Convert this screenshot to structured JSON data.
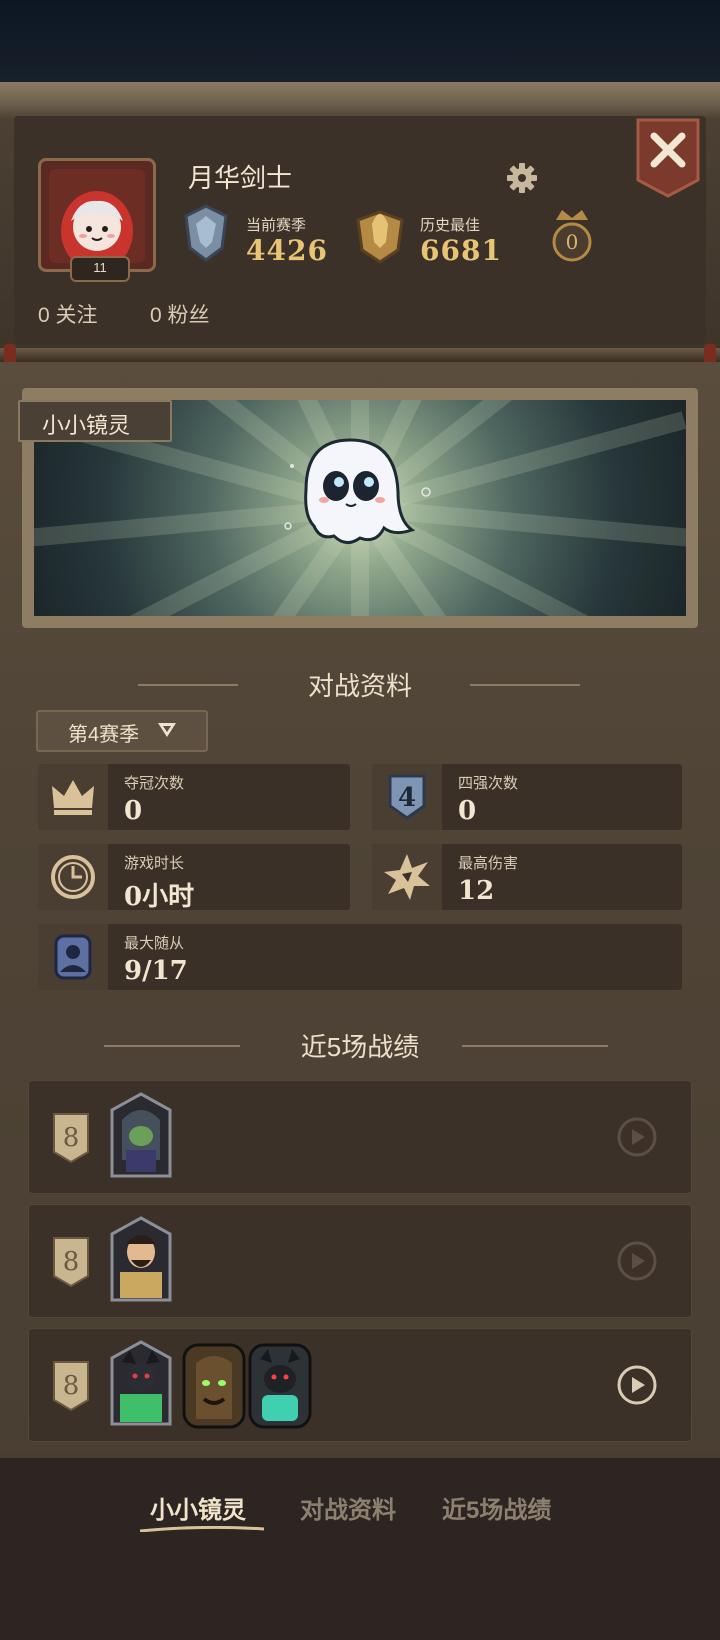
{
  "profile": {
    "name": "月华剑士",
    "level": "11",
    "current_season_label": "当前赛季",
    "current_season_value": "4426",
    "history_best_label": "历史最佳",
    "history_best_value": "6681",
    "crown_count": "0",
    "follow_count": "0",
    "follow_label": "关注",
    "fans_count": "0",
    "fans_label": "粉丝"
  },
  "pet": {
    "name": "小小镜灵"
  },
  "battle_section": {
    "title": "对战资料",
    "season_selector": "第4赛季",
    "stats": [
      {
        "label": "夺冠次数",
        "value": "0",
        "icon": "crown-icon"
      },
      {
        "label": "四强次数",
        "value": "0",
        "icon": "top4-icon"
      },
      {
        "label": "游戏时长",
        "value": "0小时",
        "icon": "clock-icon"
      },
      {
        "label": "最高伤害",
        "value": "12",
        "icon": "damage-icon"
      },
      {
        "label": "最大随从",
        "value": "9/17",
        "icon": "minion-icon"
      }
    ]
  },
  "recent_section": {
    "title": "近5场战绩",
    "matches": [
      {
        "placement": "8",
        "hero": "hooded-hero-portrait",
        "minions": []
      },
      {
        "placement": "8",
        "hero": "bearded-hero-portrait",
        "minions": []
      },
      {
        "placement": "8",
        "hero": "demon-hero-portrait",
        "minions": [
          "treant-minion",
          "demon-minion"
        ]
      }
    ]
  },
  "tabs": [
    {
      "label": "小小镜灵",
      "active": true
    },
    {
      "label": "对战资料",
      "active": false
    },
    {
      "label": "近5场战绩",
      "active": false
    }
  ],
  "colors": {
    "accent_gold": "#e9c474",
    "panel": "#4f4436",
    "card": "#3a3028"
  }
}
